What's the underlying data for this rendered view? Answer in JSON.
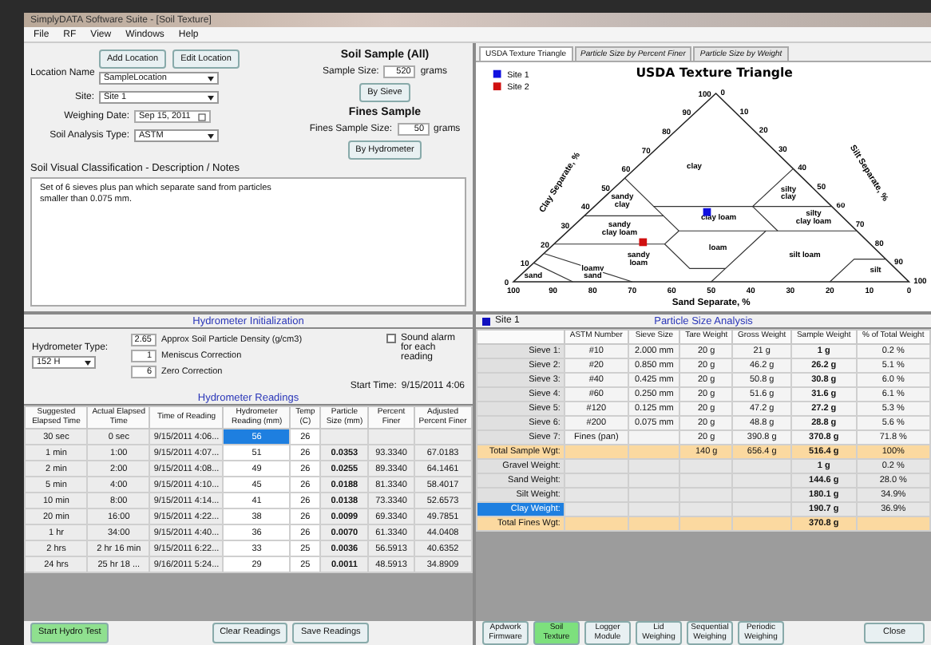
{
  "window": {
    "title": "SimplyDATA Software Suite - [Soil Texture]"
  },
  "menu": [
    "File",
    "RF",
    "View",
    "Windows",
    "Help"
  ],
  "location": {
    "label": "Location Name",
    "buttons": [
      "Add Location",
      "Edit Location"
    ],
    "name": "SampleLocation",
    "site_label": "Site:",
    "site": "Site 1",
    "date_label": "Weighing Date:",
    "date": "Sep 15, 2011",
    "type_label": "Soil Analysis Type:",
    "type": "ASTM"
  },
  "sample": {
    "title": "Soil Sample (All)",
    "size_label": "Sample Size:",
    "size": "520",
    "unit": "grams",
    "button": "By Sieve",
    "fines_title": "Fines Sample",
    "fines_label": "Fines Sample Size:",
    "fines_size": "50",
    "fines_unit": "grams",
    "fines_button": "By Hydrometer"
  },
  "notes": {
    "label": "Soil Visual Classification - Description / Notes",
    "text": "Set of 6 sieves plus pan which separate sand from particles smaller than 0.075 mm."
  },
  "chart_tabs": [
    {
      "label": "USDA Texture Triangle",
      "selected": true
    },
    {
      "label": "Particle Size by Percent Finer",
      "selected": false
    },
    {
      "label": "Particle Size by Weight",
      "selected": false
    }
  ],
  "triangle": {
    "title": "USDA Texture Triangle",
    "legend": [
      {
        "label": "Site 1",
        "color": "#1010e0"
      },
      {
        "label": "Site 2",
        "color": "#d01010"
      }
    ],
    "regions": [
      [
        "clay"
      ],
      [
        "sandy",
        "clay"
      ],
      [
        "silty",
        "clay"
      ],
      [
        "clay loam"
      ],
      [
        "silty",
        "clay loam"
      ],
      [
        "sandy",
        "clay loam"
      ],
      [
        "loam"
      ],
      [
        "silt loam"
      ],
      [
        "sandy",
        "loam"
      ],
      [
        "sand"
      ],
      [
        "loamy",
        "sand"
      ],
      [
        "silt"
      ]
    ],
    "clay_ticks": [
      "0",
      "10",
      "20",
      "30",
      "40",
      "50",
      "60",
      "70",
      "80",
      "90",
      "100"
    ],
    "silt_ticks": [
      "0",
      "10",
      "20",
      "30",
      "40",
      "50",
      "60",
      "70",
      "80",
      "90",
      "100"
    ],
    "sand_ticks": [
      "100",
      "90",
      "80",
      "70",
      "60",
      "50",
      "40",
      "30",
      "20",
      "10",
      "0"
    ],
    "clay_title": "Clay Separate, %",
    "silt_title": "Silt Separate, %",
    "sand_title": "Sand Separate, %"
  },
  "hydrometer": {
    "init_title": "Hydrometer Initialization",
    "type_label": "Hydrometer Type:",
    "type": "152 H",
    "params": [
      {
        "value": "2.65",
        "label": "Approx Soil Particle Density (g/cm3)"
      },
      {
        "value": "1",
        "label": "Meniscus Correction"
      },
      {
        "value": "6",
        "label": "Zero Correction"
      }
    ],
    "alarm": {
      "label": "Sound alarm for each reading",
      "checked": false
    },
    "start_label": "Start Time:",
    "start": "9/15/2011 4:06",
    "readings_title": "Hydrometer Readings",
    "columns": [
      "Suggested Elapsed Time",
      "Actual Elapsed Time",
      "Time of Reading",
      "Hydrometer Reading (mm)",
      "Temp (C)",
      "Particle Size (mm)",
      "Percent Finer",
      "Adjusted Percent Finer"
    ],
    "rows": [
      {
        "cells": [
          "30 sec",
          "0 sec",
          "9/15/2011 4:06...",
          "56",
          "26",
          "",
          "",
          ""
        ],
        "selected": true
      },
      {
        "cells": [
          "1 min",
          "1:00",
          "9/15/2011 4:07...",
          "51",
          "26",
          "0.0353",
          "93.3340",
          "67.0183"
        ],
        "selected": false
      },
      {
        "cells": [
          "2 min",
          "2:00",
          "9/15/2011 4:08...",
          "49",
          "26",
          "0.0255",
          "89.3340",
          "64.1461"
        ],
        "selected": false
      },
      {
        "cells": [
          "5 min",
          "4:00",
          "9/15/2011 4:10...",
          "45",
          "26",
          "0.0188",
          "81.3340",
          "58.4017"
        ],
        "selected": false
      },
      {
        "cells": [
          "10 min",
          "8:00",
          "9/15/2011 4:14...",
          "41",
          "26",
          "0.0138",
          "73.3340",
          "52.6573"
        ],
        "selected": false
      },
      {
        "cells": [
          "20 min",
          "16:00",
          "9/15/2011 4:22...",
          "38",
          "26",
          "0.0099",
          "69.3340",
          "49.7851"
        ],
        "selected": false
      },
      {
        "cells": [
          "1 hr",
          "34:00",
          "9/15/2011 4:40...",
          "36",
          "26",
          "0.0070",
          "61.3340",
          "44.0408"
        ],
        "selected": false
      },
      {
        "cells": [
          "2 hrs",
          "2 hr 16 min",
          "9/15/2011 6:22...",
          "33",
          "25",
          "0.0036",
          "56.5913",
          "40.6352"
        ],
        "selected": false
      },
      {
        "cells": [
          "24 hrs",
          "25 hr 18 ...",
          "9/16/2011 5:24...",
          "29",
          "25",
          "0.0011",
          "48.5913",
          "34.8909"
        ],
        "selected": false
      }
    ],
    "buttons": [
      {
        "label": "Start Hydro Test",
        "kind": "start"
      },
      {
        "label": "Clear Readings",
        "kind": "plain"
      },
      {
        "label": "Save Readings",
        "kind": "plain"
      }
    ]
  },
  "analysis": {
    "site": "Site 1",
    "title": "Particle Size Analysis",
    "columns": [
      "ASTM Number",
      "Sieve Size",
      "Tare Weight",
      "Gross Weight",
      "Sample Weight",
      "% of Total Weight"
    ],
    "rows": [
      {
        "label": "Sieve 1:",
        "cells": [
          "#10",
          "2.000 mm",
          "20 g",
          "21 g",
          "1 g",
          "0.2 %"
        ],
        "kind": "sieve",
        "selected": false
      },
      {
        "label": "Sieve 2:",
        "cells": [
          "#20",
          "0.850 mm",
          "20 g",
          "46.2 g",
          "26.2 g",
          "5.1 %"
        ],
        "kind": "sieve",
        "selected": false
      },
      {
        "label": "Sieve 3:",
        "cells": [
          "#40",
          "0.425 mm",
          "20 g",
          "50.8 g",
          "30.8 g",
          "6.0 %"
        ],
        "kind": "sieve",
        "selected": false
      },
      {
        "label": "Sieve 4:",
        "cells": [
          "#60",
          "0.250 mm",
          "20 g",
          "51.6 g",
          "31.6 g",
          "6.1 %"
        ],
        "kind": "sieve",
        "selected": false
      },
      {
        "label": "Sieve 5:",
        "cells": [
          "#120",
          "0.125 mm",
          "20 g",
          "47.2 g",
          "27.2 g",
          "5.3 %"
        ],
        "kind": "sieve",
        "selected": false
      },
      {
        "label": "Sieve 6:",
        "cells": [
          "#200",
          "0.075 mm",
          "20 g",
          "48.8 g",
          "28.8 g",
          "5.6 %"
        ],
        "kind": "sieve",
        "selected": false
      },
      {
        "label": "Sieve 7:",
        "cells": [
          "Fines (pan)",
          "",
          "20 g",
          "390.8 g",
          "370.8 g",
          "71.8 %"
        ],
        "kind": "sieve",
        "selected": false
      },
      {
        "label": "Total Sample Wgt:",
        "cells": [
          "",
          "",
          "140 g",
          "656.4 g",
          "516.4 g",
          "100%"
        ],
        "kind": "total",
        "selected": false
      },
      {
        "label": "Gravel Weight:",
        "cells": [
          "",
          "",
          "",
          "",
          "1 g",
          "0.2 %"
        ],
        "kind": "summary",
        "selected": false
      },
      {
        "label": "Sand Weight:",
        "cells": [
          "",
          "",
          "",
          "",
          "144.6 g",
          "28.0 %"
        ],
        "kind": "summary",
        "selected": false
      },
      {
        "label": "Silt Weight:",
        "cells": [
          "",
          "",
          "",
          "",
          "180.1 g",
          "34.9%"
        ],
        "kind": "summary",
        "selected": false
      },
      {
        "label": "Clay Weight:",
        "cells": [
          "",
          "",
          "",
          "",
          "190.7 g",
          "36.9%"
        ],
        "kind": "summary",
        "selected": true
      },
      {
        "label": "Total Fines Wgt:",
        "cells": [
          "",
          "",
          "",
          "",
          "370.8 g",
          ""
        ],
        "kind": "total",
        "selected": false
      }
    ],
    "modules": [
      {
        "label": "Apdwork Firmware",
        "selected": false
      },
      {
        "label": "Soil Texture",
        "selected": true
      },
      {
        "label": "Logger Module",
        "selected": false
      },
      {
        "label": "Lid Weighing",
        "selected": false
      },
      {
        "label": "Sequential Weighing",
        "selected": false
      },
      {
        "label": "Periodic Weighing",
        "selected": false
      }
    ],
    "close": "Close"
  }
}
